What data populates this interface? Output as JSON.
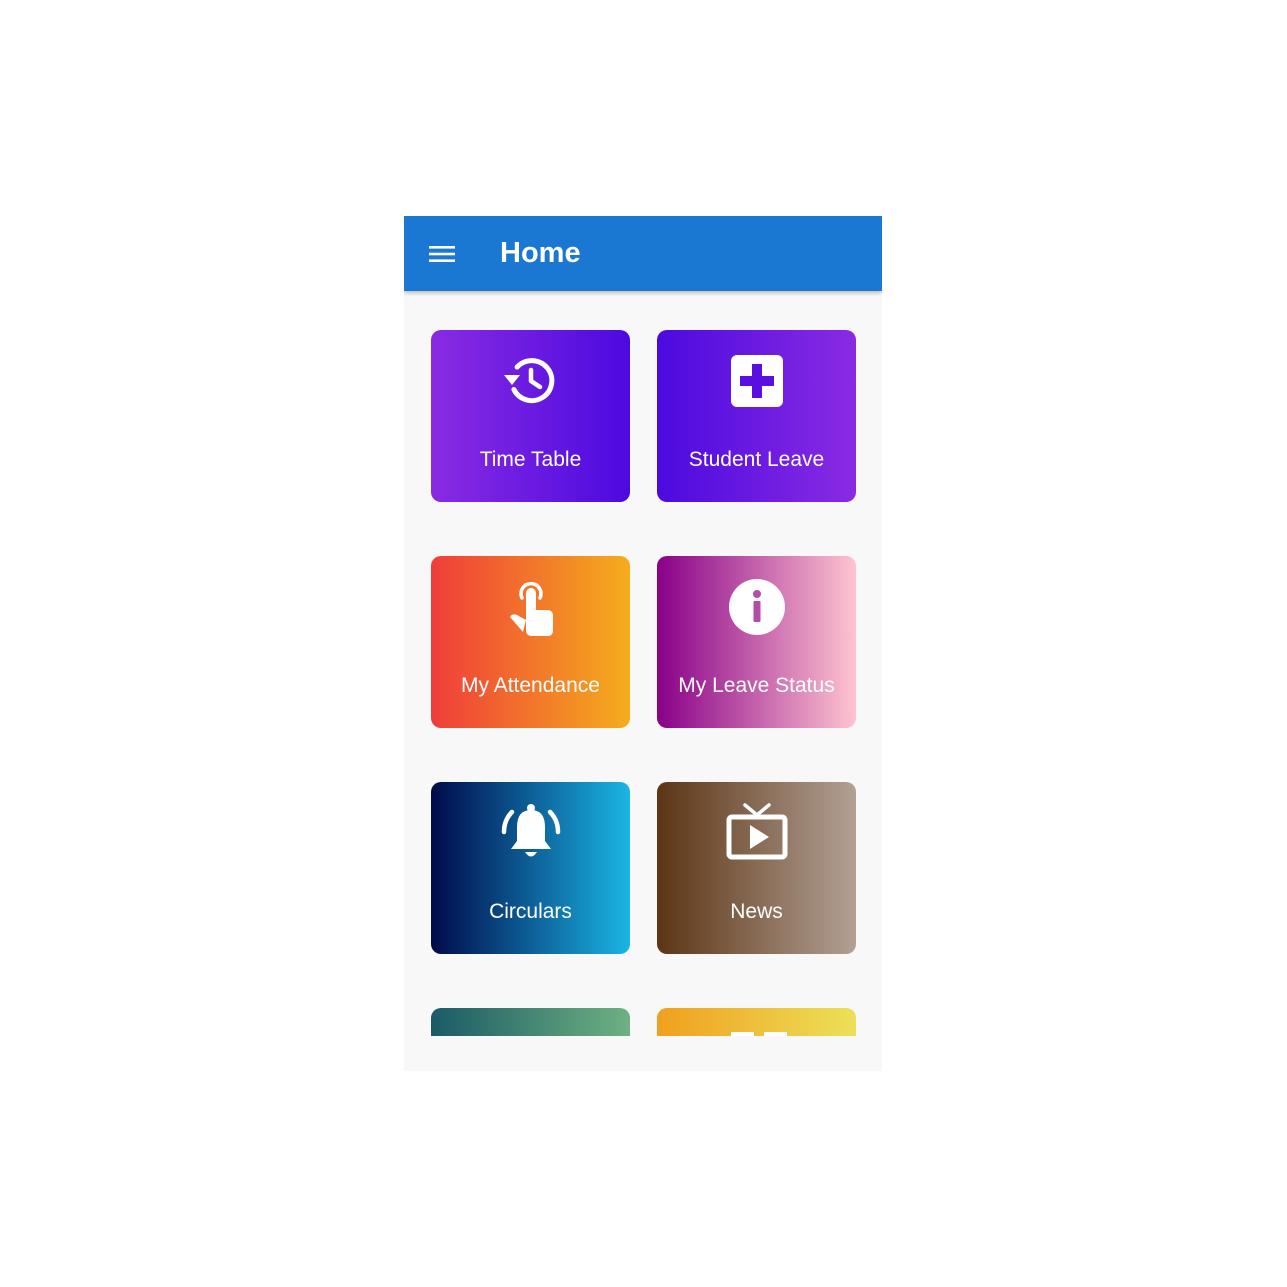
{
  "appbar": {
    "title": "Home",
    "menu_icon": "hamburger-menu-icon",
    "color": "#1a77d2"
  },
  "tiles": [
    {
      "label": "Time Table",
      "icon": "history-clock-icon",
      "gradient": [
        "#8a2be2",
        "#4b0ae0"
      ]
    },
    {
      "label": "Student Leave",
      "icon": "medical-plus-icon",
      "gradient": [
        "#4b0ae0",
        "#8a2be2"
      ]
    },
    {
      "label": "My Attendance",
      "icon": "touch-finger-icon",
      "gradient": [
        "#ef3d3a",
        "#f5ad1c"
      ]
    },
    {
      "label": "My Leave Status",
      "icon": "info-icon",
      "gradient": [
        "#880088",
        "#ffc4d0"
      ]
    },
    {
      "label": "Circulars",
      "icon": "bell-ringing-icon",
      "gradient": [
        "#000a4a",
        "#1ab5e4"
      ]
    },
    {
      "label": "News",
      "icon": "tv-play-icon",
      "gradient": [
        "#5c3515",
        "#b2a094"
      ]
    },
    {
      "label": "",
      "icon": "",
      "gradient": [
        "#1a5a66",
        "#6fb181"
      ]
    },
    {
      "label": "",
      "icon": "",
      "gradient": [
        "#f0a01e",
        "#ece058"
      ]
    }
  ]
}
